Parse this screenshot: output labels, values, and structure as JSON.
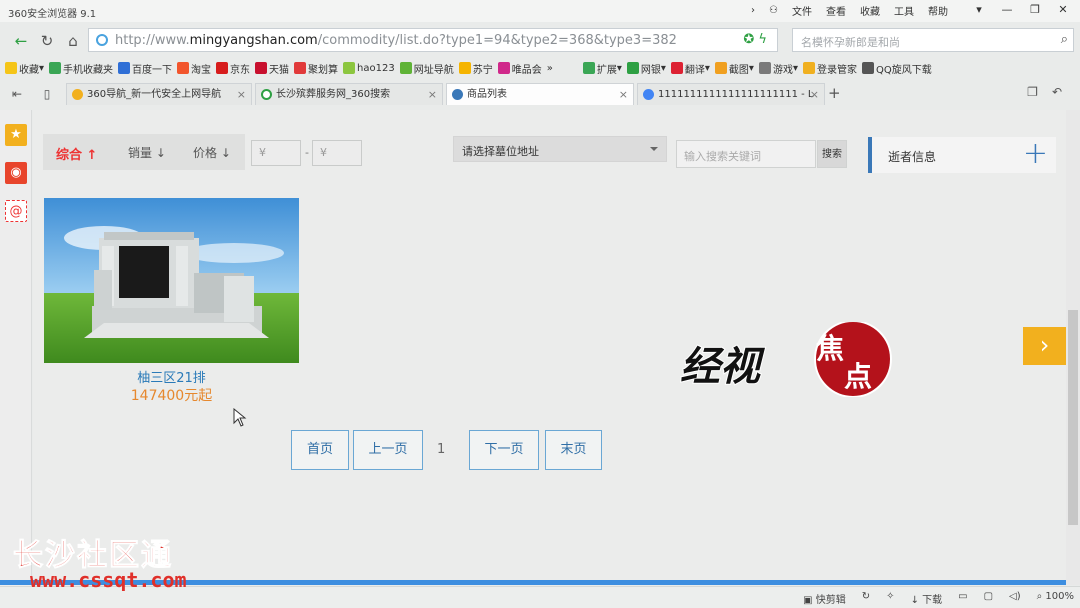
{
  "browser": {
    "title": "360安全浏览器 9.1",
    "menu": [
      "文件",
      "查看",
      "收藏",
      "工具",
      "帮助"
    ],
    "url_prefix": "http://www.",
    "url_domain": "mingyangshan.com",
    "url_path": "/commodity/list.do?type1=94&type2=368&type3=382",
    "search_placeholder": "名模怀孕新郎是和尚",
    "bookmarks": [
      "收藏",
      "手机收藏夹",
      "百度一下",
      "淘宝",
      "京东",
      "天猫",
      "聚划算",
      "hao123",
      "网址导航",
      "苏宁",
      "唯品会",
      "扩展",
      "网银",
      "翻译",
      "截图",
      "游戏",
      "登录管家",
      "QQ旋风下载"
    ],
    "tabs": [
      {
        "label": "360导航_新一代安全上网导航"
      },
      {
        "label": "长沙殡葬服务网_360搜索"
      },
      {
        "label": "商品列表"
      },
      {
        "label": "1111111111111111111111 - L"
      }
    ],
    "status": [
      "快剪辑",
      "下载",
      "100%"
    ]
  },
  "filters": {
    "comprehensive": "综合 ↑",
    "sales": "销量 ↓",
    "price": "价格 ↓",
    "price_min_placeholder": "¥",
    "price_max_placeholder": "¥",
    "dash": "-"
  },
  "location_select": "请选择墓位地址",
  "keyword_placeholder": "输入搜索关键词",
  "search_button": "搜索",
  "deceased_info": "逝者信息",
  "product": {
    "title": "柚三区21排",
    "price": "147400元起"
  },
  "pager": {
    "first": "首页",
    "prev": "上一页",
    "current": "1",
    "next": "下一页",
    "last": "末页"
  },
  "watermarks": {
    "jingshi": "经视焦点",
    "cssqt_cn": "长沙社区通",
    "cssqt_en": "www.cssqt.com"
  },
  "colors": {
    "accent_blue": "#3a78b8",
    "active_red": "#e33333",
    "price_orange": "#e6882e",
    "arrow_yellow": "#f2b01e"
  }
}
